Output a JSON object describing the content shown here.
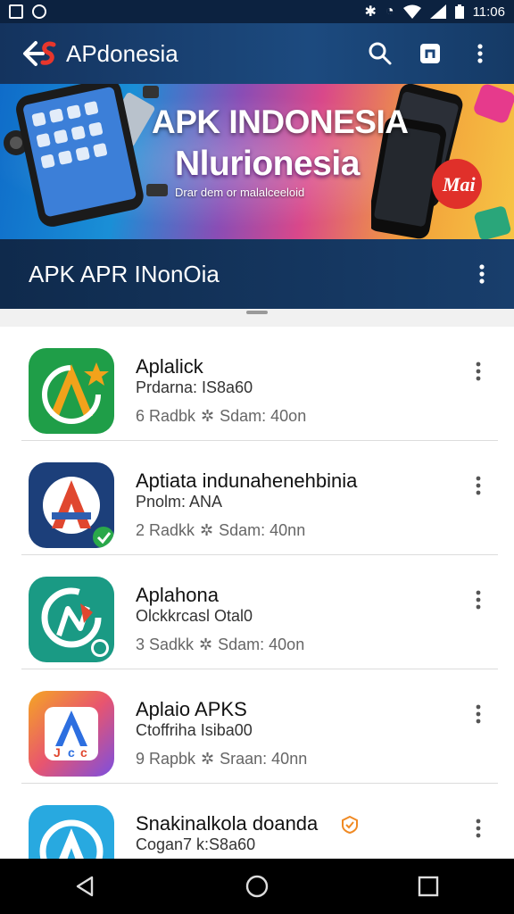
{
  "status_bar": {
    "time": "11:06",
    "left_icons": [
      "notification-icon",
      "whatsapp-icon"
    ],
    "right_icons": [
      "bluetooth-icon",
      "alarm-icon",
      "wifi-icon",
      "signal-icon",
      "battery-icon"
    ]
  },
  "toolbar": {
    "title": "APdonesia",
    "actions": [
      "search-icon",
      "share-icon",
      "more-vert-icon"
    ]
  },
  "banner": {
    "title": "APK INDONESIA",
    "subtitle": "Nlurionesia",
    "tagline": "Drar dem or malalceeloid"
  },
  "section": {
    "title": "APK APR INonOia"
  },
  "apps": [
    {
      "name": "Aplalick",
      "developer": "Prdarna: IS8a60",
      "rating": "6 Radbk",
      "size": "Sdam: 40on",
      "icon_colors": [
        "#1f9e48",
        "#0e7a34"
      ],
      "icon_accent": "#f2a21b"
    },
    {
      "name": "Aptiata indunahenehbinia",
      "developer": "Pnolm: ANA",
      "rating": "2 Radkk",
      "size": "Sdam: 40nn",
      "icon_colors": [
        "#1c3f7a",
        "#143064"
      ],
      "icon_accent": "#e0472f"
    },
    {
      "name": "Aplahona",
      "developer": "Olckkrcasl Otal0",
      "rating": "3 Sadkk",
      "size": "Sdam: 40on",
      "icon_colors": [
        "#1a9a84",
        "#0f7a69"
      ],
      "icon_accent": "#e0472f"
    },
    {
      "name": "Aplaio APKS",
      "developer": "Ctoffriha Isiba00",
      "rating": "9 Rapbk",
      "size": "Sraan: 40nn",
      "icon_colors": [
        "#f5a623",
        "#7b4fe0"
      ],
      "icon_accent": "#2d6fe0"
    },
    {
      "name": "Snakinalkola doanda",
      "developer": "Cogan7 k:S8a60",
      "rating": "",
      "size": "",
      "icon_colors": [
        "#28a9e0",
        "#1b7ec4"
      ],
      "icon_accent": "#f0a020",
      "verified": true
    }
  ],
  "nav": {
    "buttons": [
      "back-nav-icon",
      "home-nav-icon",
      "recents-nav-icon"
    ]
  }
}
